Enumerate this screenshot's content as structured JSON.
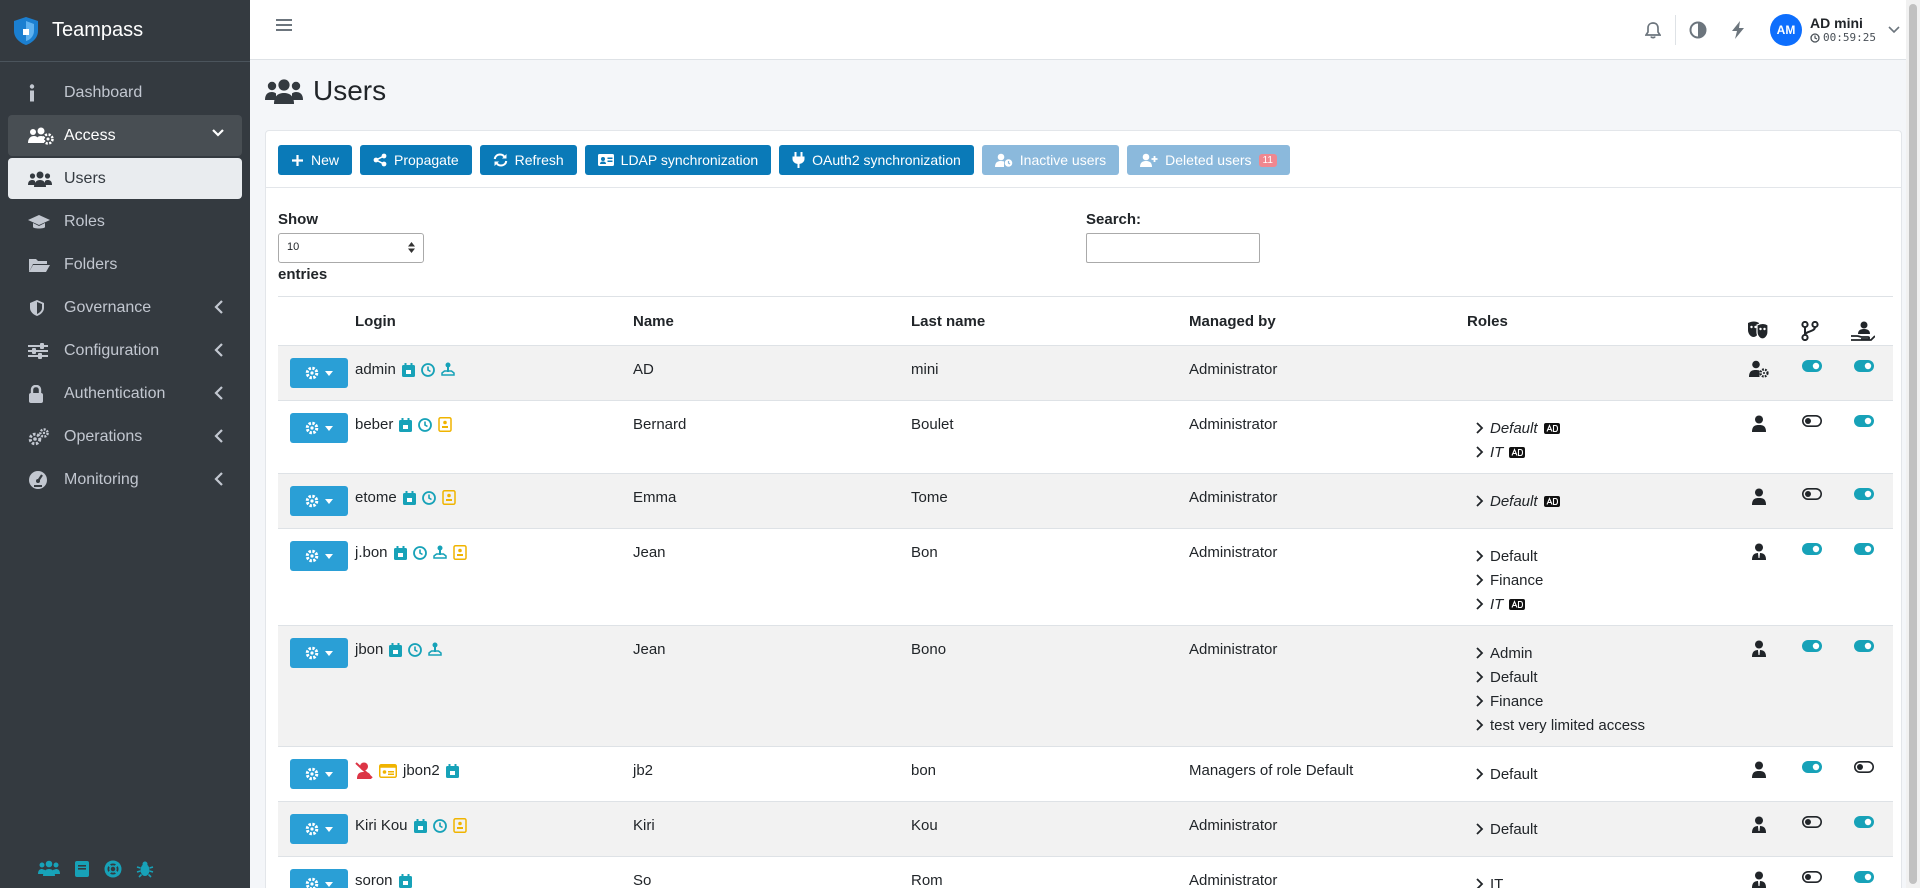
{
  "brand": {
    "name": "Teampass"
  },
  "sidebar": {
    "items": [
      {
        "label": "Dashboard",
        "icon": "info-icon"
      },
      {
        "label": "Access",
        "icon": "users-gear-icon"
      },
      {
        "label": "Users",
        "icon": "users-icon"
      },
      {
        "label": "Roles",
        "icon": "graduation-cap-icon"
      },
      {
        "label": "Folders",
        "icon": "folder-open-icon"
      },
      {
        "label": "Governance",
        "icon": "shield-icon"
      },
      {
        "label": "Configuration",
        "icon": "sliders-icon"
      },
      {
        "label": "Authentication",
        "icon": "lock-icon"
      },
      {
        "label": "Operations",
        "icon": "cogs-icon"
      },
      {
        "label": "Monitoring",
        "icon": "gauge-icon"
      }
    ]
  },
  "header": {
    "user_initials": "AM",
    "user_name": "AD mini",
    "session_timer": "00:59:25"
  },
  "page": {
    "title": "Users"
  },
  "toolbar": {
    "new_label": "New",
    "propagate_label": "Propagate",
    "refresh_label": "Refresh",
    "ldap_label": "LDAP synchronization",
    "oauth2_label": "OAuth2 synchronization",
    "inactive_label": "Inactive users",
    "deleted_label": "Deleted users",
    "deleted_count": "11"
  },
  "table_controls": {
    "show_label": "Show",
    "page_size": "10",
    "entries_label": "entries",
    "search_label": "Search:"
  },
  "table": {
    "columns": {
      "login": "Login",
      "name": "Name",
      "last_name": "Last name",
      "managed_by": "Managed by",
      "roles": "Roles"
    },
    "rows": [
      {
        "login": "admin",
        "name": "AD",
        "last_name": "mini",
        "managed_by": "Administrator",
        "roles": []
      },
      {
        "login": "beber",
        "name": "Bernard",
        "last_name": "Boulet",
        "managed_by": "Administrator",
        "roles": [
          "Default",
          "IT"
        ]
      },
      {
        "login": "etome",
        "name": "Emma",
        "last_name": "Tome",
        "managed_by": "Administrator",
        "roles": [
          "Default"
        ]
      },
      {
        "login": "j.bon",
        "name": "Jean",
        "last_name": "Bon",
        "managed_by": "Administrator",
        "roles": [
          "Default",
          "Finance",
          "IT"
        ]
      },
      {
        "login": "jbon",
        "name": "Jean",
        "last_name": "Bono",
        "managed_by": "Administrator",
        "roles": [
          "Admin",
          "Default",
          "Finance",
          "test very limited access"
        ]
      },
      {
        "login": "jbon2",
        "name": "jb2",
        "last_name": "bon",
        "managed_by": "Managers of role Default",
        "roles": [
          "Default"
        ]
      },
      {
        "login": "Kiri Kou",
        "name": "Kiri",
        "last_name": "Kou",
        "managed_by": "Administrator",
        "roles": [
          "Default"
        ]
      },
      {
        "login": "soron",
        "name": "So",
        "last_name": "Rom",
        "managed_by": "Administrator",
        "roles": [
          "IT"
        ]
      }
    ]
  },
  "colors": {
    "sidebar_bg": "#343a40",
    "primary": "#0a7ab8",
    "teal": "#17a2b8",
    "warning": "#ffc107",
    "danger": "#dc3545"
  }
}
